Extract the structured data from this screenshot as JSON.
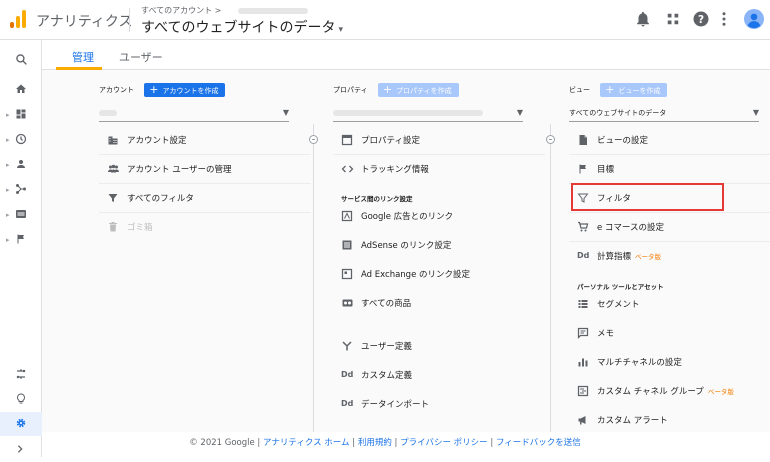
{
  "header": {
    "app_name": "アナリティクス",
    "breadcrumb_top": "すべてのアカウント >",
    "property_name": "すべてのウェブサイトのデータ",
    "caret": "▾"
  },
  "tabs": {
    "admin": "管理",
    "user": "ユーザー"
  },
  "account": {
    "heading": "アカウント",
    "create_label": "アカウントを作成",
    "items": [
      "アカウント設定",
      "アカウント ユーザーの管理",
      "すべてのフィルタ",
      "ゴミ箱"
    ]
  },
  "property": {
    "heading": "プロパティ",
    "create_label": "プロパティを作成",
    "items_top": [
      "プロパティ設定",
      "トラッキング情報"
    ],
    "section_label": "サービス間のリンク設定",
    "link_items": [
      "Google 広告とのリンク",
      "AdSense のリンク設定",
      "Ad Exchange のリンク設定",
      "すべての商品"
    ],
    "items_bottom": [
      "ユーザー定義",
      "カスタム定義",
      "データインポート"
    ]
  },
  "view": {
    "heading": "ビュー",
    "create_label": "ビューを作成",
    "selected": "すべてのウェブサイトのデータ",
    "items_top": [
      "ビューの設定",
      "目標",
      "フィルタ",
      "e コマースの設定",
      "計算指標"
    ],
    "beta_label": "ベータ版",
    "section_label": "パーソナル ツールとアセット",
    "items_bottom": [
      "セグメント",
      "メモ",
      "マルチチャネルの設定",
      "カスタム チャネル グループ",
      "カスタム アラート"
    ]
  },
  "footer": {
    "copyright": "© 2021 Google",
    "links": [
      "アナリティクス ホーム",
      "利用規約",
      "プライバシー ポリシー",
      "フィードバックを送信"
    ]
  },
  "colors": {
    "accent": "#1a73e8",
    "tab_underline": "#f9ab00",
    "highlight": "#e53935"
  }
}
